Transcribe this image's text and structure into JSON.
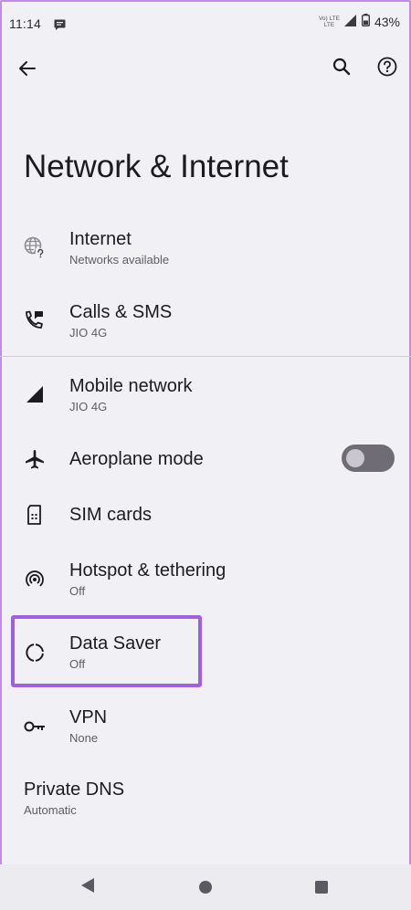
{
  "status_bar": {
    "time": "11:14",
    "volte_line1": "Vo) LTE",
    "volte_line2": "LTE",
    "battery": "43%"
  },
  "app_bar": {
    "back_icon": "arrow-left-icon",
    "search_icon": "search-icon",
    "help_icon": "help-icon"
  },
  "page": {
    "title": "Network & Internet"
  },
  "items": [
    {
      "title": "Internet",
      "subtitle": "Networks available",
      "icon": "globe-question-icon"
    },
    {
      "title": "Calls & SMS",
      "subtitle": "JIO 4G",
      "icon": "phone-message-icon"
    },
    {
      "title": "Mobile network",
      "subtitle": "JIO 4G",
      "icon": "cellular-signal-icon"
    },
    {
      "title": "Aeroplane mode",
      "icon": "airplane-icon",
      "toggle_on": false
    },
    {
      "title": "SIM cards",
      "icon": "sim-card-icon"
    },
    {
      "title": "Hotspot & tethering",
      "subtitle": "Off",
      "icon": "hotspot-icon"
    },
    {
      "title": "Data Saver",
      "subtitle": "Off",
      "icon": "data-saver-icon",
      "highlighted": true
    },
    {
      "title": "VPN",
      "subtitle": "None",
      "icon": "vpn-key-icon"
    },
    {
      "title": "Private DNS",
      "subtitle": "Automatic"
    }
  ],
  "colors": {
    "background": "#f1f0f5",
    "highlight": "#a05fe0",
    "frame": "#c18be8"
  },
  "nav_bar": {
    "back_icon": "triangle-back-icon",
    "home_icon": "circle-home-icon",
    "recents_icon": "square-recents-icon"
  }
}
